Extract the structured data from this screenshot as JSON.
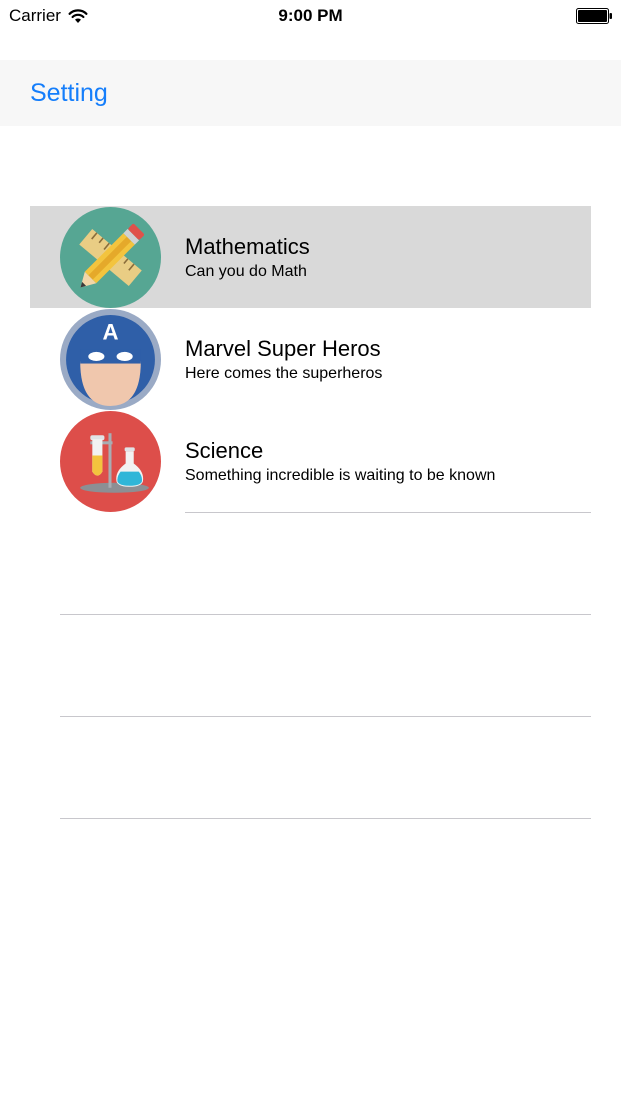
{
  "status_bar": {
    "carrier": "Carrier",
    "time": "9:00 PM",
    "icons": [
      "wifi-icon",
      "battery-icon"
    ]
  },
  "nav": {
    "back_label": "Setting"
  },
  "colors": {
    "tint": "#157efb",
    "selected_row": "#d9d9d9",
    "separator": "#c8c7cc"
  },
  "topics": [
    {
      "title": "Mathematics",
      "subtitle": "Can you do Math",
      "icon": "math-icon",
      "selected": true
    },
    {
      "title": "Marvel Super Heros",
      "subtitle": "Here comes the superheros",
      "icon": "superhero-icon",
      "selected": false
    },
    {
      "title": "Science",
      "subtitle": "Something incredible is waiting to be known",
      "icon": "science-icon",
      "selected": false
    }
  ]
}
